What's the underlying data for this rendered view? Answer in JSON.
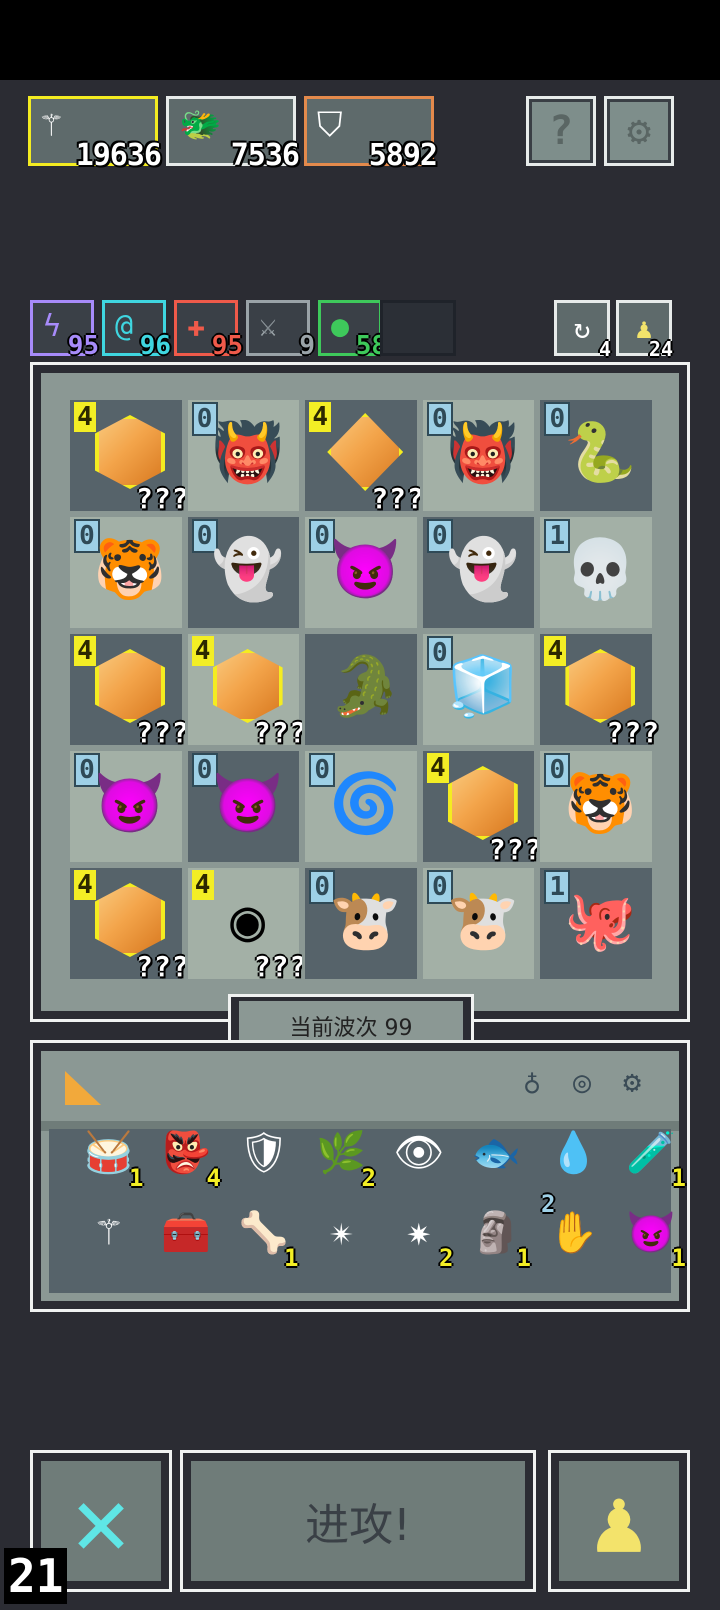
{
  "resources": [
    {
      "icon": "staff-icon",
      "glyph": "⚚",
      "value": "19636",
      "border": "#f4ec21"
    },
    {
      "icon": "dragon-head-icon",
      "glyph": "🐲",
      "value": "7536",
      "border": "#e7ebea"
    },
    {
      "icon": "bone-shield-icon",
      "glyph": "⛉",
      "value": "5892",
      "border": "#e48a4c"
    }
  ],
  "top_buttons": {
    "help_glyph": "?",
    "settings_glyph": "⚙"
  },
  "stats": [
    {
      "icon": "lightning-icon",
      "glyph": "ϟ",
      "value": "95",
      "color": "#a78bfa"
    },
    {
      "icon": "swirl-icon",
      "glyph": "@",
      "value": "96",
      "color": "#3fd6e0"
    },
    {
      "icon": "cross-icon",
      "glyph": "✚",
      "value": "95",
      "color": "#ef5a4a"
    },
    {
      "icon": "sword-icon",
      "glyph": "⚔",
      "value": "9",
      "color": "#9aa3a8"
    },
    {
      "icon": "heart-icon",
      "glyph": "●",
      "value": "58",
      "color": "#3ec95b"
    }
  ],
  "side_counters": [
    {
      "icon": "reroll-icon",
      "glyph": "↻",
      "value": "4"
    },
    {
      "icon": "pawn-icon",
      "glyph": "♟",
      "value": "24"
    }
  ],
  "board": [
    [
      {
        "t": "gem",
        "lvl": "4",
        "q": "???"
      },
      {
        "t": "unit",
        "lvl": "0",
        "g": "👹",
        "c": "#c0392b"
      },
      {
        "t": "diamond",
        "lvl": "4",
        "q": "???"
      },
      {
        "t": "unit",
        "lvl": "0",
        "g": "👹",
        "c": "#c0392b"
      },
      {
        "t": "unit",
        "lvl": "0",
        "g": "🐍",
        "c": "#2e8b57"
      }
    ],
    [
      {
        "t": "unit",
        "lvl": "0",
        "g": "🐯",
        "c": "#f39c4a"
      },
      {
        "t": "unit",
        "lvl": "0",
        "g": "👻",
        "c": "#dfe6e9"
      },
      {
        "t": "unit",
        "lvl": "0",
        "g": "😈",
        "c": "#9b3fc9"
      },
      {
        "t": "unit",
        "lvl": "0",
        "g": "👻",
        "c": "#dfe6e9"
      },
      {
        "t": "unit",
        "lvl": "1",
        "g": "💀",
        "c": "#eeeeee"
      }
    ],
    [
      {
        "t": "gem",
        "lvl": "4",
        "q": "???"
      },
      {
        "t": "gem",
        "lvl": "4",
        "q": "???"
      },
      {
        "t": "unit",
        "lvl": "",
        "g": "🐊",
        "c": "#2fa04a"
      },
      {
        "t": "unit",
        "lvl": "0",
        "g": "🧊",
        "c": "#6ec6f0"
      },
      {
        "t": "gem",
        "lvl": "4",
        "q": "???"
      }
    ],
    [
      {
        "t": "unit",
        "lvl": "0",
        "g": "😈",
        "c": "#9b3fc9"
      },
      {
        "t": "unit",
        "lvl": "0",
        "g": "😈",
        "c": "#9b3fc9"
      },
      {
        "t": "unit",
        "lvl": "0",
        "g": "🌀",
        "c": "#3b6fd9"
      },
      {
        "t": "gem",
        "lvl": "4",
        "q": "???"
      },
      {
        "t": "unit",
        "lvl": "0",
        "g": "🐯",
        "c": "#f39c4a"
      }
    ],
    [
      {
        "t": "gem",
        "lvl": "4",
        "q": "???"
      },
      {
        "t": "unit",
        "lvl": "4",
        "g": "◉",
        "c": "#000000",
        "q": "???",
        "yellow": true
      },
      {
        "t": "unit",
        "lvl": "0",
        "g": "🐮",
        "c": "#3e8a4a"
      },
      {
        "t": "unit",
        "lvl": "0",
        "g": "🐮",
        "c": "#3e8a4a"
      },
      {
        "t": "unit",
        "lvl": "1",
        "g": "🐙",
        "c": "#6b5b95"
      }
    ]
  ],
  "wave": {
    "label": "当前波次 99"
  },
  "inventory": {
    "tab_icon": "cheese-icon",
    "filters": [
      {
        "icon": "helmet-filter-icon",
        "glyph": "♁"
      },
      {
        "icon": "ring-filter-icon",
        "glyph": "◎"
      },
      {
        "icon": "gear-filter-icon",
        "glyph": "⚙"
      }
    ],
    "items": [
      {
        "icon": "drum-icon",
        "glyph": "🥁",
        "count": "1"
      },
      {
        "icon": "goblin-icon",
        "glyph": "👺",
        "count": "4"
      },
      {
        "icon": "shield-icon",
        "glyph": "🛡",
        "count": ""
      },
      {
        "icon": "herb-icon",
        "glyph": "🌿",
        "count": "2"
      },
      {
        "icon": "eye-orb-icon",
        "glyph": "👁",
        "count": ""
      },
      {
        "icon": "fish-icon",
        "glyph": "🐟",
        "count": ""
      },
      {
        "icon": "water-drop-icon",
        "glyph": "💧",
        "count": ""
      },
      {
        "icon": "potion-jar-icon",
        "glyph": "🧪",
        "count": "1"
      },
      {
        "icon": "staff-icon",
        "glyph": "⚚",
        "count": ""
      },
      {
        "icon": "treasure-chest-icon",
        "glyph": "🧰",
        "count": ""
      },
      {
        "icon": "claw-icon",
        "glyph": "🦴",
        "count": "1"
      },
      {
        "icon": "shuriken-icon",
        "glyph": "✴",
        "count": ""
      },
      {
        "icon": "star-burst-icon",
        "glyph": "✷",
        "count": "2"
      },
      {
        "icon": "totem-icon",
        "glyph": "🗿",
        "count": "1"
      },
      {
        "icon": "hand-icon",
        "glyph": "✋",
        "count": "",
        "top": "2"
      },
      {
        "icon": "demon-face-icon",
        "glyph": "😈",
        "count": "1"
      }
    ]
  },
  "bottom": {
    "cancel_glyph": "✕",
    "attack_label": "进攻!",
    "pawn_glyph": "♟",
    "counter": "21"
  }
}
